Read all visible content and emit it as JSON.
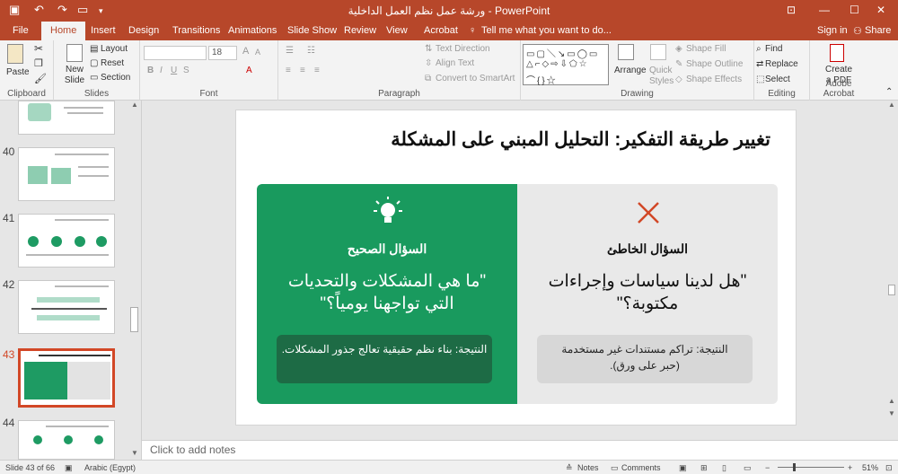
{
  "title_bar": {
    "title": "ورشة عمل نظم العمل الداخلية - PowerPoint"
  },
  "tabs": [
    "File",
    "Home",
    "Insert",
    "Design",
    "Transitions",
    "Animations",
    "Slide Show",
    "Review",
    "View",
    "Acrobat"
  ],
  "tell_me": "Tell me what you want to do...",
  "account": {
    "sign_in": "Sign in",
    "share": "Share"
  },
  "ribbon": {
    "clipboard": {
      "label": "Clipboard",
      "paste": "Paste"
    },
    "slides": {
      "label": "Slides",
      "new_slide": "New Slide",
      "layout": "Layout",
      "reset": "Reset",
      "section": "Section"
    },
    "font": {
      "label": "Font",
      "size": "18"
    },
    "paragraph": {
      "label": "Paragraph",
      "text_direction": "Text Direction",
      "align_text": "Align Text",
      "smartart": "Convert to SmartArt"
    },
    "drawing": {
      "label": "Drawing",
      "arrange": "Arrange",
      "quick_styles": "Quick Styles",
      "shape_fill": "Shape Fill",
      "shape_outline": "Shape Outline",
      "shape_effects": "Shape Effects"
    },
    "editing": {
      "label": "Editing",
      "find": "Find",
      "replace": "Replace",
      "select": "Select"
    },
    "acrobat": {
      "label": "Adobe Acrobat",
      "create_pdf": "Create a PDF"
    }
  },
  "thumbnails": [
    {
      "number": "40",
      "selected": false
    },
    {
      "number": "41",
      "selected": false
    },
    {
      "number": "42",
      "selected": false
    },
    {
      "number": "43",
      "selected": true
    },
    {
      "number": "44",
      "selected": false
    }
  ],
  "slide": {
    "title": "تغيير طريقة التفكير: التحليل المبني على المشكلة",
    "right_panel": {
      "heading": "السؤال الصحيح",
      "quote": "\"ما هي المشكلات والتحديات التي تواجهنا يومياً؟\"",
      "result": "النتيجة: بناء نظم حقيقية تعالج جذور المشكلات."
    },
    "left_panel": {
      "heading": "السؤال الخاطئ",
      "quote": "\"هل لدينا سياسات وإجراءات مكتوبة؟\"",
      "result": "النتيجة: تراكم مستندات غير مستخدمة (حبر على ورق)."
    }
  },
  "notes_placeholder": "Click to add notes",
  "status": {
    "slide_info": "Slide 43 of 66",
    "language": "Arabic (Egypt)",
    "notes": "Notes",
    "comments": "Comments",
    "zoom": "51%"
  },
  "colors": {
    "accent": "#b7472a",
    "green": "#199a5e",
    "dark_green": "#1d6b45",
    "red": "#d24726"
  }
}
